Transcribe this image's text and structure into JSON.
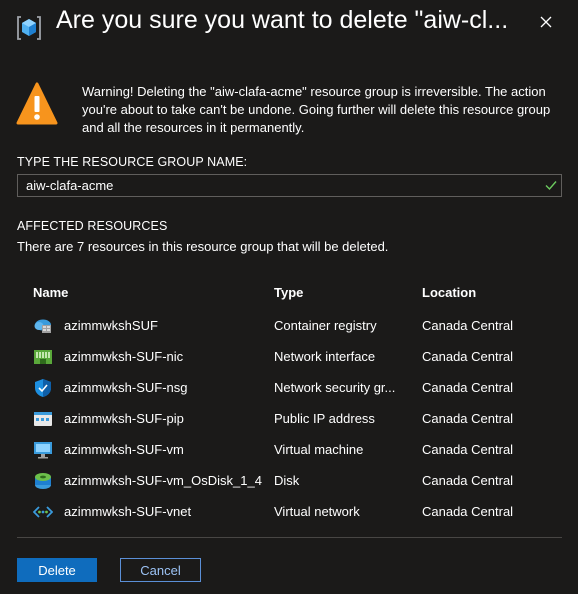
{
  "dialog": {
    "title": "Are you sure you want to delete \"aiw-cl...",
    "warning": "Warning! Deleting the \"aiw-clafa-acme\" resource group is irreversible. The action you're about to take can't be undone. Going further will delete this resource group and all the resources in it permanently.",
    "input_label": "TYPE THE RESOURCE GROUP NAME:",
    "input_value": "aiw-clafa-acme",
    "affected_heading": "AFFECTED RESOURCES",
    "affected_desc": "There are 7 resources in this resource group that will be deleted.",
    "columns": {
      "name": "Name",
      "type": "Type",
      "location": "Location"
    },
    "resources": [
      {
        "name": "azimmwkshSUF",
        "type": "Container registry",
        "location": "Canada Central",
        "icon": "container-registry-icon"
      },
      {
        "name": "azimmwksh-SUF-nic",
        "type": "Network interface",
        "location": "Canada Central",
        "icon": "network-interface-icon"
      },
      {
        "name": "azimmwksh-SUF-nsg",
        "type": "Network security gr...",
        "location": "Canada Central",
        "icon": "network-security-group-icon"
      },
      {
        "name": "azimmwksh-SUF-pip",
        "type": "Public IP address",
        "location": "Canada Central",
        "icon": "public-ip-icon"
      },
      {
        "name": "azimmwksh-SUF-vm",
        "type": "Virtual machine",
        "location": "Canada Central",
        "icon": "virtual-machine-icon"
      },
      {
        "name": "azimmwksh-SUF-vm_OsDisk_1_4...",
        "type": "Disk",
        "location": "Canada Central",
        "icon": "disk-icon"
      },
      {
        "name": "azimmwksh-SUF-vnet",
        "type": "Virtual network",
        "location": "Canada Central",
        "icon": "virtual-network-icon"
      }
    ],
    "delete_label": "Delete",
    "cancel_label": "Cancel"
  },
  "colors": {
    "background": "#1b1a19",
    "accent": "#0f6cbd",
    "warning": "#f7941d",
    "success": "#6ccb5f"
  }
}
